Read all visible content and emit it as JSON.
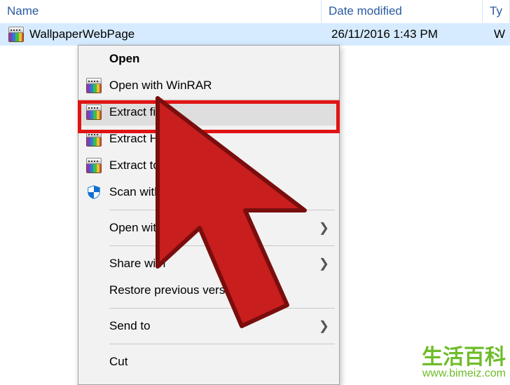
{
  "columns": {
    "name": "Name",
    "date": "Date modified",
    "type": "Ty"
  },
  "file": {
    "name": "WallpaperWebPage",
    "date": "26/11/2016 1:43 PM",
    "type": "W"
  },
  "menu": {
    "open": "Open",
    "open_winrar": "Open with WinRAR",
    "extract_files": "Extract files...",
    "extract_here": "Extract Here",
    "extract_to": "Extract to Wa",
    "scan_defender": "Scan with Win",
    "open_with": "Open with",
    "share_with": "Share with",
    "restore_prev": "Restore previous vers",
    "send_to": "Send to",
    "cut": "Cut"
  },
  "glyph": {
    "submenu": "❯"
  },
  "watermark": {
    "title": "生活百科",
    "url": "www.bimeiz.com"
  }
}
